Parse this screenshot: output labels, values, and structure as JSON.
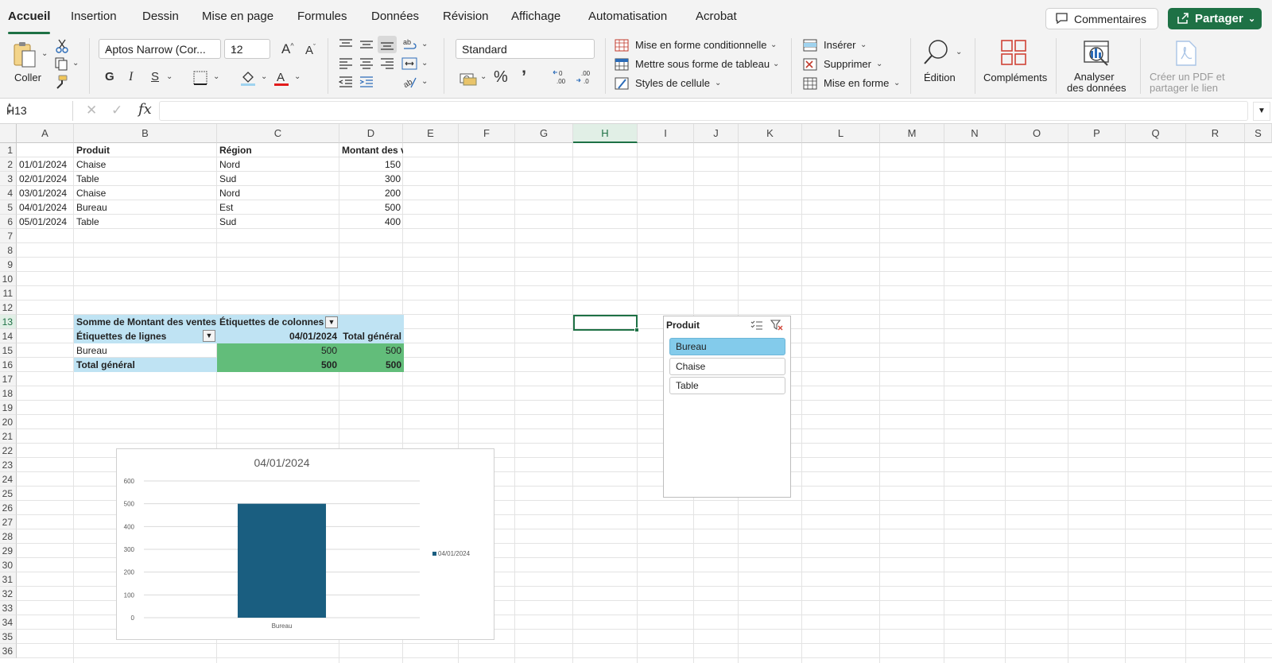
{
  "app_tabs": [
    "Accueil",
    "Insertion",
    "Dessin",
    "Mise en page",
    "Formules",
    "Données",
    "Révision",
    "Affichage",
    "Automatisation",
    "Acrobat"
  ],
  "active_tab": "Accueil",
  "header_buttons": {
    "comments": "Commentaires",
    "share": "Partager"
  },
  "ribbon": {
    "paste_label": "Coller",
    "font_name": "Aptos Narrow (Cor...",
    "font_size": "12",
    "bold": "G",
    "italic": "I",
    "underline": "S",
    "number_format": "Standard",
    "styles": {
      "conditional": "Mise en forme conditionnelle",
      "as_table": "Mettre sous forme de tableau",
      "cell_styles": "Styles de cellule"
    },
    "cells": {
      "insert": "Insérer",
      "delete": "Supprimer",
      "format": "Mise en forme"
    },
    "editing": "Édition",
    "addins": "Compléments",
    "analyze_line1": "Analyser",
    "analyze_line2": "des données",
    "pdf_line1": "Créer un PDF et",
    "pdf_line2": "partager le lien"
  },
  "formula_bar": {
    "name_box": "H13",
    "fx": "fx",
    "formula": ""
  },
  "columns": [
    "A",
    "B",
    "C",
    "D",
    "E",
    "F",
    "G",
    "H",
    "I",
    "J",
    "K",
    "L",
    "M",
    "N",
    "O",
    "P",
    "Q",
    "R",
    "S"
  ],
  "selected_column": "H",
  "selected_row": "13",
  "rows": [
    "1",
    "2",
    "3",
    "4",
    "5",
    "6",
    "7",
    "8",
    "9",
    "10",
    "11",
    "12",
    "13",
    "14",
    "15",
    "16",
    "17",
    "18",
    "19",
    "20",
    "21",
    "22",
    "23",
    "24",
    "25",
    "26",
    "27",
    "28",
    "29",
    "30",
    "31",
    "32",
    "33",
    "34",
    "35",
    "36"
  ],
  "table": {
    "headers": [
      "",
      "Produit",
      "Région",
      "Montant des ventes"
    ],
    "rows": [
      [
        "01/01/2024",
        "Chaise",
        "Nord",
        "150"
      ],
      [
        "02/01/2024",
        "Table",
        "Sud",
        "300"
      ],
      [
        "03/01/2024",
        "Chaise",
        "Nord",
        "200"
      ],
      [
        "04/01/2024",
        "Bureau",
        "Est",
        "500"
      ],
      [
        "05/01/2024",
        "Table",
        "Sud",
        "400"
      ]
    ]
  },
  "pivot": {
    "sum_label": "Somme de Montant des ventes",
    "col_labels": "Étiquettes de colonnes",
    "row_labels": "Étiquettes de lignes",
    "col_date": "04/01/2024",
    "grand_total_label": "Total général",
    "row_item": "Bureau",
    "row_value": "500",
    "row_total": "500",
    "grand_value": "500",
    "grand_total": "500"
  },
  "slicer": {
    "title": "Produit",
    "items": [
      {
        "label": "Bureau",
        "selected": true
      },
      {
        "label": "Chaise",
        "selected": false
      },
      {
        "label": "Table",
        "selected": false
      }
    ]
  },
  "chart_data": {
    "type": "bar",
    "title": "04/01/2024",
    "categories": [
      "Bureau"
    ],
    "series": [
      {
        "name": "04/01/2024",
        "values": [
          500
        ]
      }
    ],
    "ylim": [
      0,
      600
    ],
    "yticks": [
      0,
      100,
      200,
      300,
      400,
      500,
      600
    ],
    "grid": true,
    "legend": "right",
    "color": "#1a5e80"
  },
  "colors": {
    "accent": "#1e7145",
    "pivot_header": "#bfe3f3",
    "pivot_values": "#62bd7a",
    "slicer_selected": "#83cbeb"
  }
}
